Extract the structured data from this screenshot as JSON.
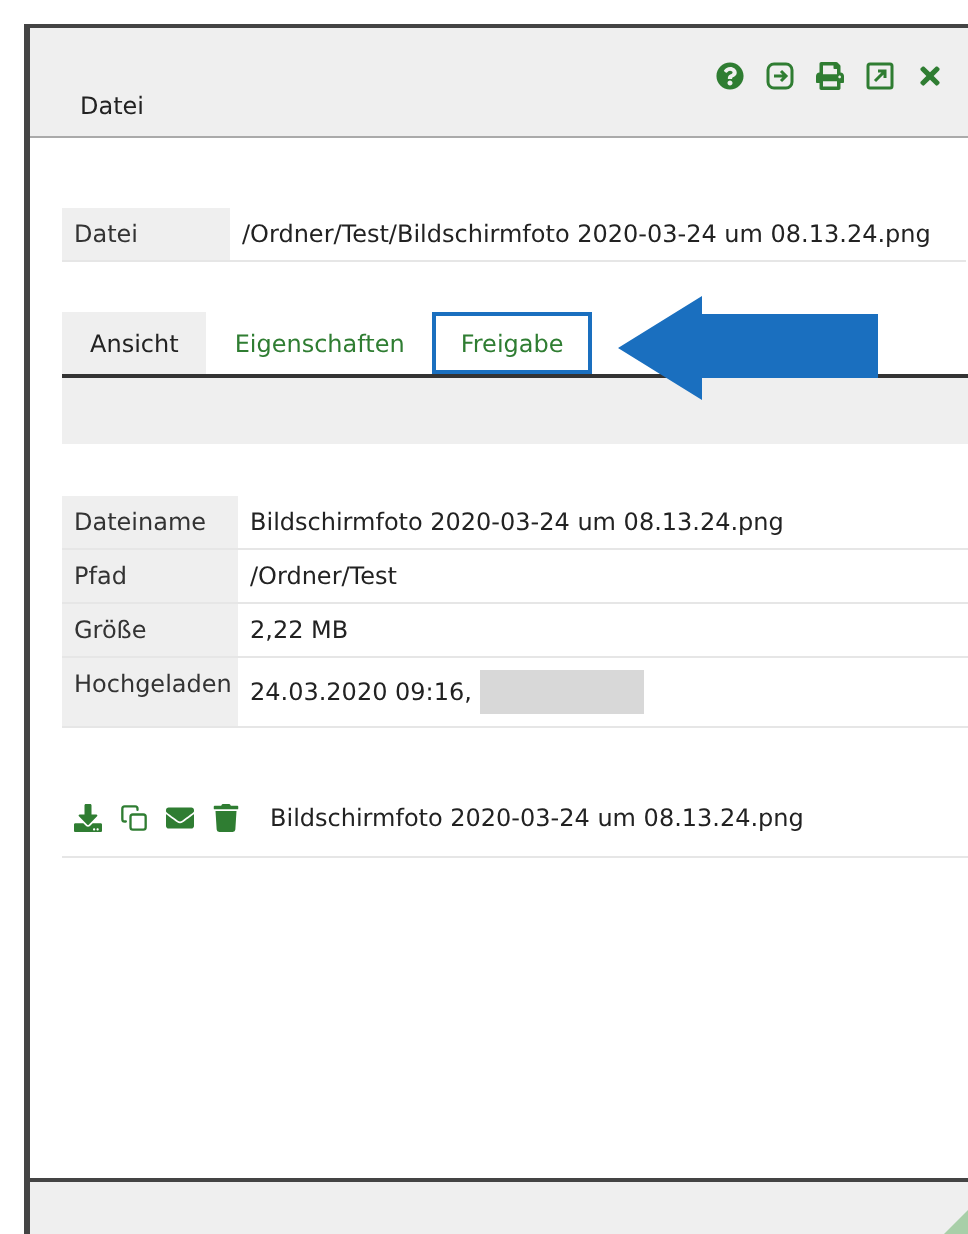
{
  "window": {
    "title": "Datei"
  },
  "path_field": {
    "label": "Datei",
    "value": "/Ordner/Test/Bildschirmfoto 2020-03-24 um 08.13.24.png"
  },
  "tabs": [
    {
      "label": "Ansicht",
      "selected": true,
      "highlighted": false
    },
    {
      "label": "Eigenschaften",
      "selected": false,
      "highlighted": false
    },
    {
      "label": "Freigabe",
      "selected": false,
      "highlighted": true
    }
  ],
  "details": [
    {
      "label": "Dateiname",
      "value": "Bildschirmfoto 2020-03-24 um 08.13.24.png",
      "redacted": false
    },
    {
      "label": "Pfad",
      "value": "/Ordner/Test",
      "redacted": false
    },
    {
      "label": "Größe",
      "value": "2,22 MB",
      "redacted": false
    },
    {
      "label": "Hochgeladen",
      "value": "24.03.2020 09:16,",
      "redacted": true
    }
  ],
  "attachment": {
    "name": "Bildschirmfoto 2020-03-24 um 08.13.24.png"
  }
}
